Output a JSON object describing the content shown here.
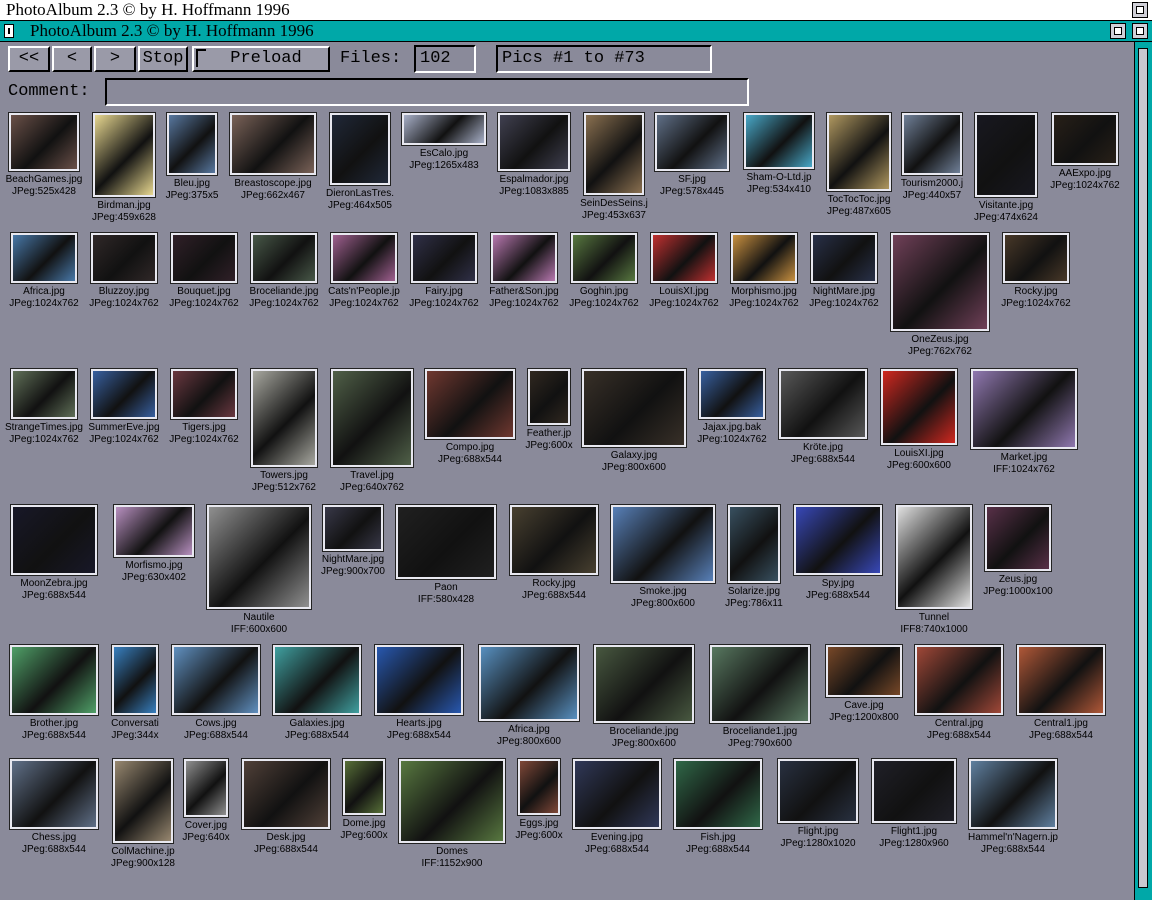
{
  "screen": {
    "title": "PhotoAlbum 2.3 © by H. Hoffmann 1996"
  },
  "window": {
    "title": "PhotoAlbum 2.3 © by H. Hoffmann 1996"
  },
  "toolbar": {
    "first_label": "<<",
    "prev_label": "<",
    "next_label": ">",
    "stop_label": "Stop",
    "preload_label": "Preload",
    "files_label": "Files:",
    "files_value": "102",
    "pics_range": "Pics #1 to #73",
    "comment_label": "Comment:",
    "comment_value": ""
  },
  "colors": {
    "accent": "#00a8a8",
    "background": "#8a8a9a",
    "screen_bar": "#ffffff"
  },
  "thumbnails": [
    {
      "name": "BeachGames.jpg",
      "info": "JPeg:525x428",
      "color": "#6a5048"
    },
    {
      "name": "Birdman.jpg",
      "info": "JPeg:459x628",
      "color": "#e8d890"
    },
    {
      "name": "Bleu.jpg",
      "info": "JPeg:375x5",
      "color": "#5878a0"
    },
    {
      "name": "Breastoscope.jpg",
      "info": "JPeg:662x467",
      "color": "#7a6258"
    },
    {
      "name": "DieronLasTres.",
      "info": "JPeg:464x505",
      "color": "#202838"
    },
    {
      "name": "EsCalo.jpg",
      "info": "JPeg:1265x483",
      "color": "#a8b0c8"
    },
    {
      "name": "Espalmador.jpg",
      "info": "JPeg:1083x885",
      "color": "#404050"
    },
    {
      "name": "SeinDesSeins.j",
      "info": "JPeg:453x637",
      "color": "#8a7050"
    },
    {
      "name": "SF.jpg",
      "info": "JPeg:578x445",
      "color": "#607088"
    },
    {
      "name": "Sham-O-Ltd.jp",
      "info": "JPeg:534x410",
      "color": "#48a8c8"
    },
    {
      "name": "TocTocToc.jpg",
      "info": "JPeg:487x605",
      "color": "#b09860"
    },
    {
      "name": "Tourism2000.j",
      "info": "JPeg:440x57",
      "color": "#708098"
    },
    {
      "name": "Visitante.jpg",
      "info": "JPeg:474x624",
      "color": "#181820"
    },
    {
      "name": "AAExpo.jpg",
      "info": "JPeg:1024x762",
      "color": "#282018"
    },
    {
      "name": "Africa.jpg",
      "info": "JPeg:1024x762",
      "color": "#4878a8"
    },
    {
      "name": "Bluzzoy.jpg",
      "info": "JPeg:1024x762",
      "color": "#302828"
    },
    {
      "name": "Bouquet.jpg",
      "info": "JPeg:1024x762",
      "color": "#302028"
    },
    {
      "name": "Broceliande.jpg",
      "info": "JPeg:1024x762",
      "color": "#485848"
    },
    {
      "name": "Cats'n'People.jp",
      "info": "JPeg:1024x762",
      "color": "#a06090"
    },
    {
      "name": "Fairy.jpg",
      "info": "JPeg:1024x762",
      "color": "#303048"
    },
    {
      "name": "Father&Son.jpg",
      "info": "JPeg:1024x762",
      "color": "#b878b0"
    },
    {
      "name": "Goghin.jpg",
      "info": "JPeg:1024x762",
      "color": "#587840"
    },
    {
      "name": "LouisXI.jpg",
      "info": "JPeg:1024x762",
      "color": "#c03030"
    },
    {
      "name": "Morphismo.jpg",
      "info": "JPeg:1024x762",
      "color": "#c89040"
    },
    {
      "name": "NightMare.jpg",
      "info": "JPeg:1024x762",
      "color": "#283048"
    },
    {
      "name": "OneZeus.jpg",
      "info": "JPeg:762x762",
      "color": "#704058"
    },
    {
      "name": "Rocky.jpg",
      "info": "JPeg:1024x762",
      "color": "#483828"
    },
    {
      "name": "StrangeTimes.jpg",
      "info": "JPeg:1024x762",
      "color": "#607058"
    },
    {
      "name": "SummerEve.jpg",
      "info": "JPeg:1024x762",
      "color": "#3860a0"
    },
    {
      "name": "Tigers.jpg",
      "info": "JPeg:1024x762",
      "color": "#6a3840"
    },
    {
      "name": "Towers.jpg",
      "info": "JPeg:512x762",
      "color": "#a8a8a0"
    },
    {
      "name": "Travel.jpg",
      "info": "JPeg:640x762",
      "color": "#506048"
    },
    {
      "name": "Compo.jpg",
      "info": "JPeg:688x544",
      "color": "#703830"
    },
    {
      "name": "Feather.jp",
      "info": "JPeg:600x",
      "color": "#302820"
    },
    {
      "name": "Galaxy.jpg",
      "info": "JPeg:800x600",
      "color": "#383028"
    },
    {
      "name": "Jajax.jpg.bak",
      "info": "JPeg:1024x762",
      "color": "#3860a0"
    },
    {
      "name": "Kröte.jpg",
      "info": "JPeg:688x544",
      "color": "#585858"
    },
    {
      "name": "LouisXI.jpg",
      "info": "JPeg:600x600",
      "color": "#d02820"
    },
    {
      "name": "Market.jpg",
      "info": "IFF:1024x762",
      "color": "#9078b0"
    },
    {
      "name": "MoonZebra.jpg",
      "info": "JPeg:688x544",
      "color": "#181828"
    },
    {
      "name": "Morfismo.jpg",
      "info": "JPeg:630x402",
      "color": "#b890c0"
    },
    {
      "name": "Nautile",
      "info": "IFF:600x600",
      "color": "#909090"
    },
    {
      "name": "NightMare.jpg",
      "info": "JPeg:900x700",
      "color": "#383848"
    },
    {
      "name": "Paon",
      "info": "IFF:580x428",
      "color": "#202020"
    },
    {
      "name": "Rocky.jpg",
      "info": "JPeg:688x544",
      "color": "#484030"
    },
    {
      "name": "Smoke.jpg",
      "info": "JPeg:800x600",
      "color": "#5880b8"
    },
    {
      "name": "Solarize.jpg",
      "info": "JPeg:786x11",
      "color": "#385060"
    },
    {
      "name": "Spy.jpg",
      "info": "JPeg:688x544",
      "color": "#3848b8"
    },
    {
      "name": "Tunnel",
      "info": "IFF8:740x1000",
      "color": "#e0e0e0"
    },
    {
      "name": "Zeus.jpg",
      "info": "JPeg:1000x100",
      "color": "#583048"
    },
    {
      "name": "Brother.jpg",
      "info": "JPeg:688x544",
      "color": "#50a068"
    },
    {
      "name": "Conversati",
      "info": "JPeg:344x",
      "color": "#3880c0"
    },
    {
      "name": "Cows.jpg",
      "info": "JPeg:688x544",
      "color": "#6090c0"
    },
    {
      "name": "Galaxies.jpg",
      "info": "JPeg:688x544",
      "color": "#40a0a0"
    },
    {
      "name": "Hearts.jpg",
      "info": "JPeg:688x544",
      "color": "#2858b0"
    },
    {
      "name": "Africa.jpg",
      "info": "JPeg:800x600",
      "color": "#5890c0"
    },
    {
      "name": "Broceliande.jpg",
      "info": "JPeg:800x600",
      "color": "#485840"
    },
    {
      "name": "Broceliande1.jpg",
      "info": "JPeg:790x600",
      "color": "#587860"
    },
    {
      "name": "Cave.jpg",
      "info": "JPeg:1200x800",
      "color": "#784828"
    },
    {
      "name": "Central.jpg",
      "info": "JPeg:688x544",
      "color": "#a04838"
    },
    {
      "name": "Central1.jpg",
      "info": "JPeg:688x544",
      "color": "#b05838"
    },
    {
      "name": "Chess.jpg",
      "info": "JPeg:688x544",
      "color": "#607088"
    },
    {
      "name": "ColMachine.jp",
      "info": "JPeg:900x128",
      "color": "#988870"
    },
    {
      "name": "Cover.jpg",
      "info": "JPeg:640x",
      "color": "#909090"
    },
    {
      "name": "Desk.jpg",
      "info": "JPeg:688x544",
      "color": "#504038"
    },
    {
      "name": "Dome.jpg",
      "info": "JPeg:600x",
      "color": "#587038"
    },
    {
      "name": "Domes",
      "info": "IFF:1152x900",
      "color": "#587840"
    },
    {
      "name": "Eggs.jpg",
      "info": "JPeg:600x",
      "color": "#804838"
    },
    {
      "name": "Evening.jpg",
      "info": "JPeg:688x544",
      "color": "#303858"
    },
    {
      "name": "Fish.jpg",
      "info": "JPeg:688x544",
      "color": "#306848"
    },
    {
      "name": "Flight.jpg",
      "info": "JPeg:1280x1020",
      "color": "#283040"
    },
    {
      "name": "Flight1.jpg",
      "info": "JPeg:1280x960",
      "color": "#202028"
    },
    {
      "name": "Hammel'n'Nagern.jp",
      "info": "JPeg:688x544",
      "color": "#6080a0"
    }
  ]
}
